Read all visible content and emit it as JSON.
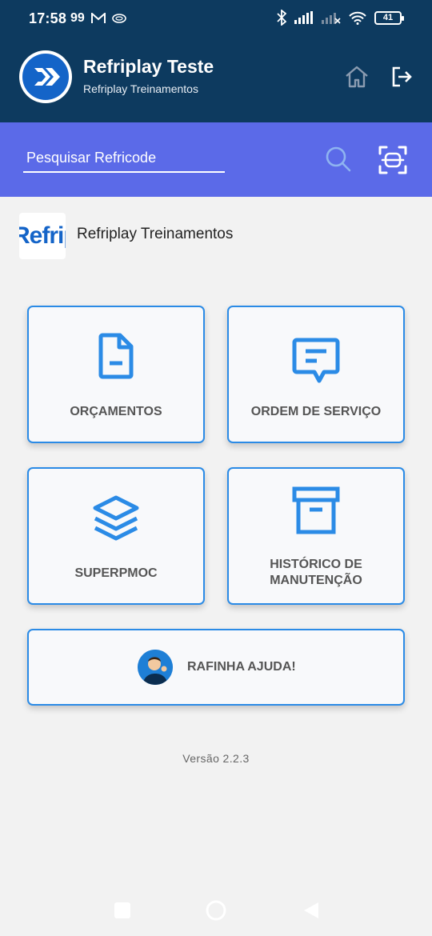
{
  "status_bar": {
    "time": "17:58",
    "extra": "99",
    "battery": "41"
  },
  "header": {
    "title": "Refriplay Teste",
    "subtitle": "Refriplay Treinamentos",
    "home_icon": "home-icon",
    "logout_icon": "logout-icon"
  },
  "search": {
    "placeholder": "Pesquisar Refricode",
    "value": ""
  },
  "company": {
    "logo_text": "Refrip",
    "name": "Refriplay Treinamentos"
  },
  "cards": [
    {
      "label": "ORÇAMENTOS",
      "icon": "document-icon"
    },
    {
      "label": "ORDEM DE SERVIÇO",
      "icon": "message-icon"
    },
    {
      "label": "SUPERPMOC",
      "icon": "layers-icon"
    },
    {
      "label": "HISTÓRICO DE MANUTENÇÃO",
      "icon": "archive-icon"
    }
  ],
  "help": {
    "label": "RAFINHA AJUDA!",
    "icon": "avatar-icon"
  },
  "version": "Versão 2.2.3",
  "colors": {
    "header_bg": "#0d3a5f",
    "search_bg": "#5b6ae8",
    "accent": "#2b8be6",
    "page_bg": "#f2f2f2"
  }
}
